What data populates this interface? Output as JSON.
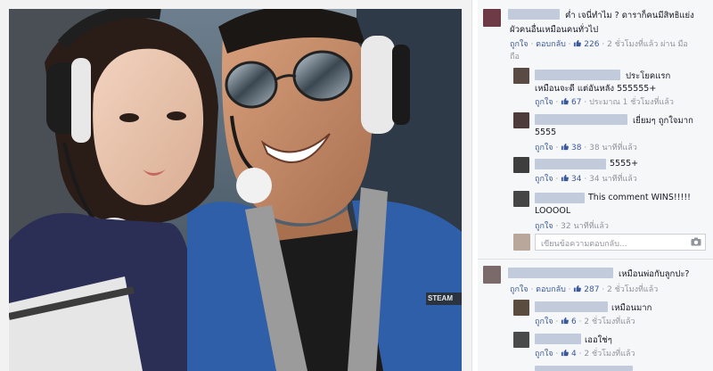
{
  "comments": [
    {
      "text_line1": "ค่ำ เจนี่ทำไม ? ดาราก็คนมีสิทธิแย่ง",
      "text_line2": "ผัวคนอื่นเหมือนคนทั่วไป",
      "like_label": "ถูกใจ",
      "reply_label": "ตอบกลับ",
      "likes": "226",
      "time": "2 ชั่วโมงที่แล้ว ผ่าน มือถือ",
      "time_line1": "2 ชั่วโมงที่แล้ว ผ่าน มือ",
      "time_line2": "ถือ"
    },
    {
      "text_line1": "ประโยคแรก",
      "text_line2": "เหมือนจะดี แต่อันหลัง 555555+",
      "like_label": "ถูกใจ",
      "likes": "67",
      "time": "ประมาณ 1 ชั่วโมงที่แล้ว"
    },
    {
      "text_line1": "เยี่ยมๆ ถูกใจมาก",
      "text_line2": "5555",
      "like_label": "ถูกใจ",
      "likes": "38",
      "time": "38 นาทีที่แล้ว"
    },
    {
      "text_line1": "5555+",
      "like_label": "ถูกใจ",
      "likes": "34",
      "time": "34 นาทีที่แล้ว"
    },
    {
      "text_line1": "This comment WINS!!!!!",
      "text_line2": "LOOOOL",
      "like_label": "ถูกใจ",
      "time": "32 นาทีที่แล้ว"
    },
    {
      "text_line1": "เหมือนพ่อกับลูกปะ?",
      "like_label": "ถูกใจ",
      "reply_label": "ตอบกลับ",
      "likes": "287",
      "time": "2 ชั่วโมงที่แล้ว"
    },
    {
      "text_line1": "เหมือนมาก",
      "like_label": "ถูกใจ",
      "likes": "6",
      "time": "2 ชั่วโมงที่แล้ว"
    },
    {
      "text_line1": "เออใช่ๆ",
      "like_label": "ถูกใจ",
      "likes": "4",
      "time": "2 ชั่วโมงที่แล้ว"
    }
  ],
  "reply_placeholder": "เขียนข้อความตอบกลับ...",
  "photo_text": "STEAM",
  "icons": [
    "thumbs-up-icon",
    "camera-icon"
  ],
  "colors": {
    "link": "#3b5998",
    "meta": "#90949c",
    "name_blur": "#b9c3d6",
    "panel_bg": "#f6f7f9"
  }
}
